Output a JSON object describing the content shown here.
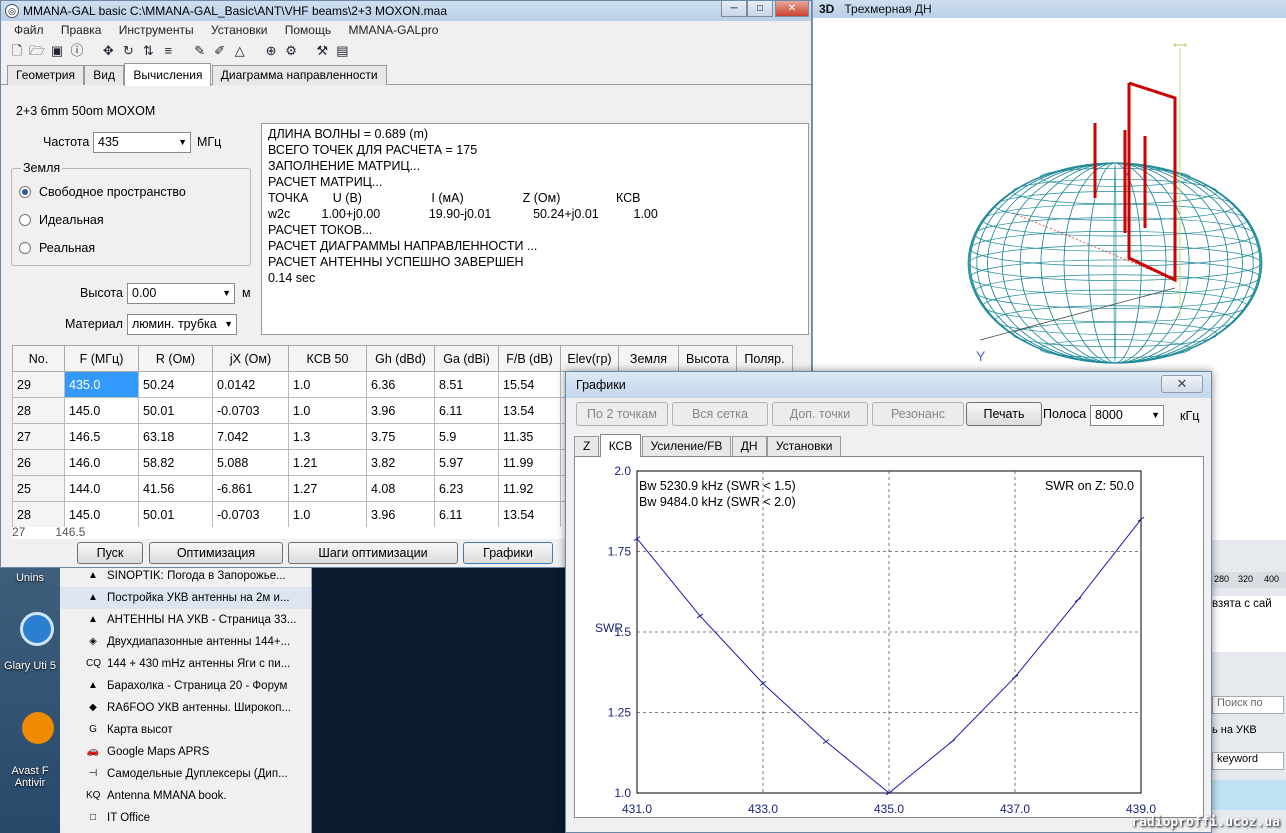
{
  "main_window": {
    "title": "MMANA-GAL basic C:\\MMANA-GAL_Basic\\ANT\\VHF beams\\2+3 MOXON.maa",
    "menu": [
      "Файл",
      "Правка",
      "Инструменты",
      "Установки",
      "Помощь",
      "MMANA-GALpro"
    ],
    "tabs": [
      "Геометрия",
      "Вид",
      "Вычисления",
      "Диаграмма направленности"
    ],
    "antenna_name": "2+3 6mm  50om  MOXOM",
    "freq_label": "Частота",
    "freq_value": "435",
    "freq_unit": "МГц",
    "ground_group": "Земля",
    "ground_options": [
      "Свободное пространство",
      "Идеальная",
      "Реальная"
    ],
    "height_label": "Высота",
    "height_value": "0.00",
    "height_unit": "м",
    "material_label": "Материал",
    "material_value": "люмин. трубка",
    "output_lines": [
      "ДЛИНА ВОЛНЫ = 0.689 (m)",
      "ВСЕГО ТОЧЕК ДЛЯ РАСЧЕТА = 175",
      "ЗАПОЛНЕНИЕ МАТРИЦ...",
      "РАСЧЕТ МАТРИЦ...",
      "ТОЧКА       U (В)                    I (мА)                 Z (Ом)                КСВ",
      "w2c         1.00+j0.00              19.90-j0.01            50.24+j0.01          1.00",
      "РАСЧЕТ ТОКОВ...",
      "РАСЧЕТ ДИАГРАММЫ НАПРАВЛЕННОСТИ ...",
      "РАСЧЕТ АНТЕННЫ УСПЕШНО ЗАВЕРШЕН",
      "0.14 sec"
    ],
    "table_headers": [
      "No.",
      "F (МГц)",
      "R (Ом)",
      "jX (Ом)",
      "КСВ 50",
      "Gh (dBd)",
      "Ga (dBi)",
      "F/B (dB)",
      "Elev(гр)",
      "Земля",
      "Высота",
      "Поляр."
    ],
    "table_rows": [
      [
        "29",
        "435.0",
        "50.24",
        "0.0142",
        "1.0",
        "6.36",
        "8.51",
        "15.54"
      ],
      [
        "28",
        "145.0",
        "50.01",
        "-0.0703",
        "1.0",
        "3.96",
        "6.11",
        "13.54"
      ],
      [
        "27",
        "146.5",
        "63.18",
        "7.042",
        "1.3",
        "3.75",
        "5.9",
        "11.35"
      ],
      [
        "26",
        "146.0",
        "58.82",
        "5.088",
        "1.21",
        "3.82",
        "5.97",
        "11.99"
      ],
      [
        "25",
        "144.0",
        "41.56",
        "-6.861",
        "1.27",
        "4.08",
        "6.23",
        "11.92"
      ],
      [
        "28",
        "145.0",
        "50.01",
        "-0.0703",
        "1.0",
        "3.96",
        "6.11",
        "13.54"
      ]
    ],
    "buttons": [
      "Пуск",
      "Оптимизация",
      "Шаги оптимизации",
      "Графики"
    ]
  },
  "window_3d": {
    "title": "Трехмерная ДН",
    "badge": "3D",
    "axis_label": "Y"
  },
  "graph_window": {
    "title": "Графики",
    "close_label": "✕",
    "buttons": [
      "По 2 точкам",
      "Вся сетка",
      "Доп. точки",
      "Резонанс",
      "Печать"
    ],
    "band_label": "Полоса",
    "band_value": "8000",
    "band_unit": "кГц",
    "tabs": [
      "Z",
      "КСВ",
      "Усиление/FB",
      "ДН",
      "Установки"
    ],
    "info_left_1": "Bw 5230.9 kHz (SWR < 1.5)",
    "info_left_2": "Bw 9484.0 kHz (SWR < 2.0)",
    "info_right": "SWR on Z: 50.0",
    "line_color": "#1a1aaa"
  },
  "chart_data": {
    "type": "line",
    "title": "",
    "xlabel": "",
    "ylabel": "SWR",
    "xlim": [
      431.0,
      439.0
    ],
    "ylim": [
      1.0,
      2.0
    ],
    "x_ticks": [
      "431.0",
      "433.0",
      "435.0",
      "437.0",
      "439.0"
    ],
    "y_ticks": [
      "2.0",
      "1.75",
      "1.5",
      "1.25",
      "1.0"
    ],
    "grid": true,
    "series": [
      {
        "x": [
          431.0,
          432.0,
          433.0,
          434.0,
          435.0,
          436.0,
          437.0,
          438.0,
          439.0
        ],
        "y": [
          1.79,
          1.55,
          1.34,
          1.16,
          1.0,
          1.16,
          1.36,
          1.6,
          1.85
        ]
      }
    ]
  },
  "taskbar_list": [
    {
      "icon": "▲",
      "label": "SINOPTIK: Погода в Запорожье..."
    },
    {
      "icon": "▲",
      "label": "Постройка УКВ антенны на 2м и..."
    },
    {
      "icon": "▲",
      "label": "АНТЕННЫ НА УКВ - Страница 33..."
    },
    {
      "icon": "◈",
      "label": "Двухдиапазонные антенны 144+..."
    },
    {
      "icon": "CQ",
      "label": "144 + 430 mHz антенны Яги с пи..."
    },
    {
      "icon": "▲",
      "label": "Барахолка - Страница 20 - Форум"
    },
    {
      "icon": "◆",
      "label": "RA6FOO УКВ антенны. Широкоп..."
    },
    {
      "icon": "G",
      "label": "Карта высот"
    },
    {
      "icon": "🚗",
      "label": "Google Maps APRS"
    },
    {
      "icon": "⊣",
      "label": "Самодельные Дуплексеры (Дип..."
    },
    {
      "icon": "KQ",
      "label": "Antenna MMANA book."
    },
    {
      "icon": "□",
      "label": "IT Office"
    }
  ],
  "desktop_icons": [
    {
      "label": "Unins"
    },
    {
      "label": "Glary Uti 5"
    },
    {
      "label": "Avast F Antivir"
    }
  ],
  "right_pane": {
    "zoom_tabs": [
      "280",
      "320",
      "400"
    ],
    "text_1": "взята с сай",
    "search_placeholder": "Поиск по",
    "text_2": "ь на УКВ",
    "keyword": "keyword"
  },
  "watermark": "radioproffi.ucoz.ua"
}
